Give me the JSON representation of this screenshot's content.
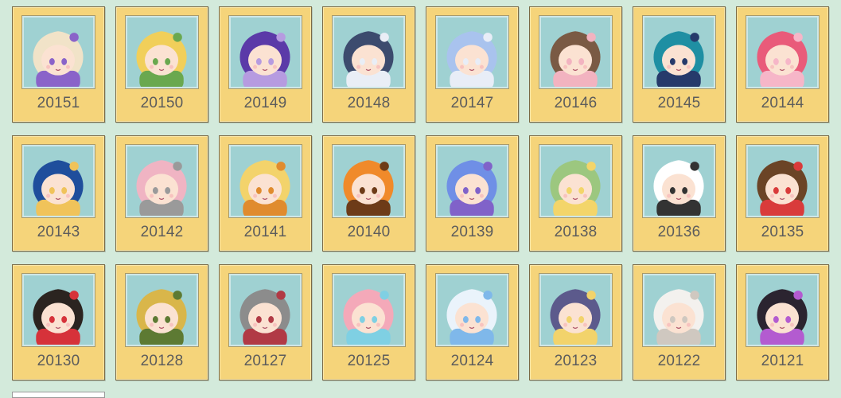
{
  "cards": [
    {
      "id": "20151",
      "hair": "#f1e3c8",
      "accent": "#8a63c9"
    },
    {
      "id": "20150",
      "hair": "#f1cf5a",
      "accent": "#6aa84f"
    },
    {
      "id": "20149",
      "hair": "#5b3aa8",
      "accent": "#b69be0"
    },
    {
      "id": "20148",
      "hair": "#3c4b6e",
      "accent": "#e9eef6"
    },
    {
      "id": "20147",
      "hair": "#a9c3ee",
      "accent": "#e8edf7"
    },
    {
      "id": "20146",
      "hair": "#7a5a44",
      "accent": "#f2b3c0"
    },
    {
      "id": "20145",
      "hair": "#1f8fa3",
      "accent": "#263a6b"
    },
    {
      "id": "20144",
      "hair": "#e95b7a",
      "accent": "#f6b6c8"
    },
    {
      "id": "20143",
      "hair": "#1f4e9c",
      "accent": "#f0c35a"
    },
    {
      "id": "20142",
      "hair": "#f0b4c3",
      "accent": "#9a9a9a"
    },
    {
      "id": "20141",
      "hair": "#f3d36b",
      "accent": "#e08b2e"
    },
    {
      "id": "20140",
      "hair": "#f08a2a",
      "accent": "#6d3b18"
    },
    {
      "id": "20139",
      "hair": "#6f8fe6",
      "accent": "#8062c9"
    },
    {
      "id": "20138",
      "hair": "#9cc77f",
      "accent": "#f3d56a"
    },
    {
      "id": "20136",
      "hair": "#ffffff",
      "accent": "#333333"
    },
    {
      "id": "20135",
      "hair": "#6b4426",
      "accent": "#d93b3b"
    },
    {
      "id": "20130",
      "hair": "#2b2420",
      "accent": "#d6323a"
    },
    {
      "id": "20128",
      "hair": "#d9b64a",
      "accent": "#5d7a33"
    },
    {
      "id": "20127",
      "hair": "#8c8c8c",
      "accent": "#b13a45"
    },
    {
      "id": "20125",
      "hair": "#f4a9b9",
      "accent": "#7fd0e3"
    },
    {
      "id": "20124",
      "hair": "#eaf3fb",
      "accent": "#7fb8ea"
    },
    {
      "id": "20123",
      "hair": "#5c5a8c",
      "accent": "#f2d36b"
    },
    {
      "id": "20122",
      "hair": "#f3f1ee",
      "accent": "#cfc8c0"
    },
    {
      "id": "20121",
      "hair": "#2b2430",
      "accent": "#b35bd0"
    }
  ]
}
